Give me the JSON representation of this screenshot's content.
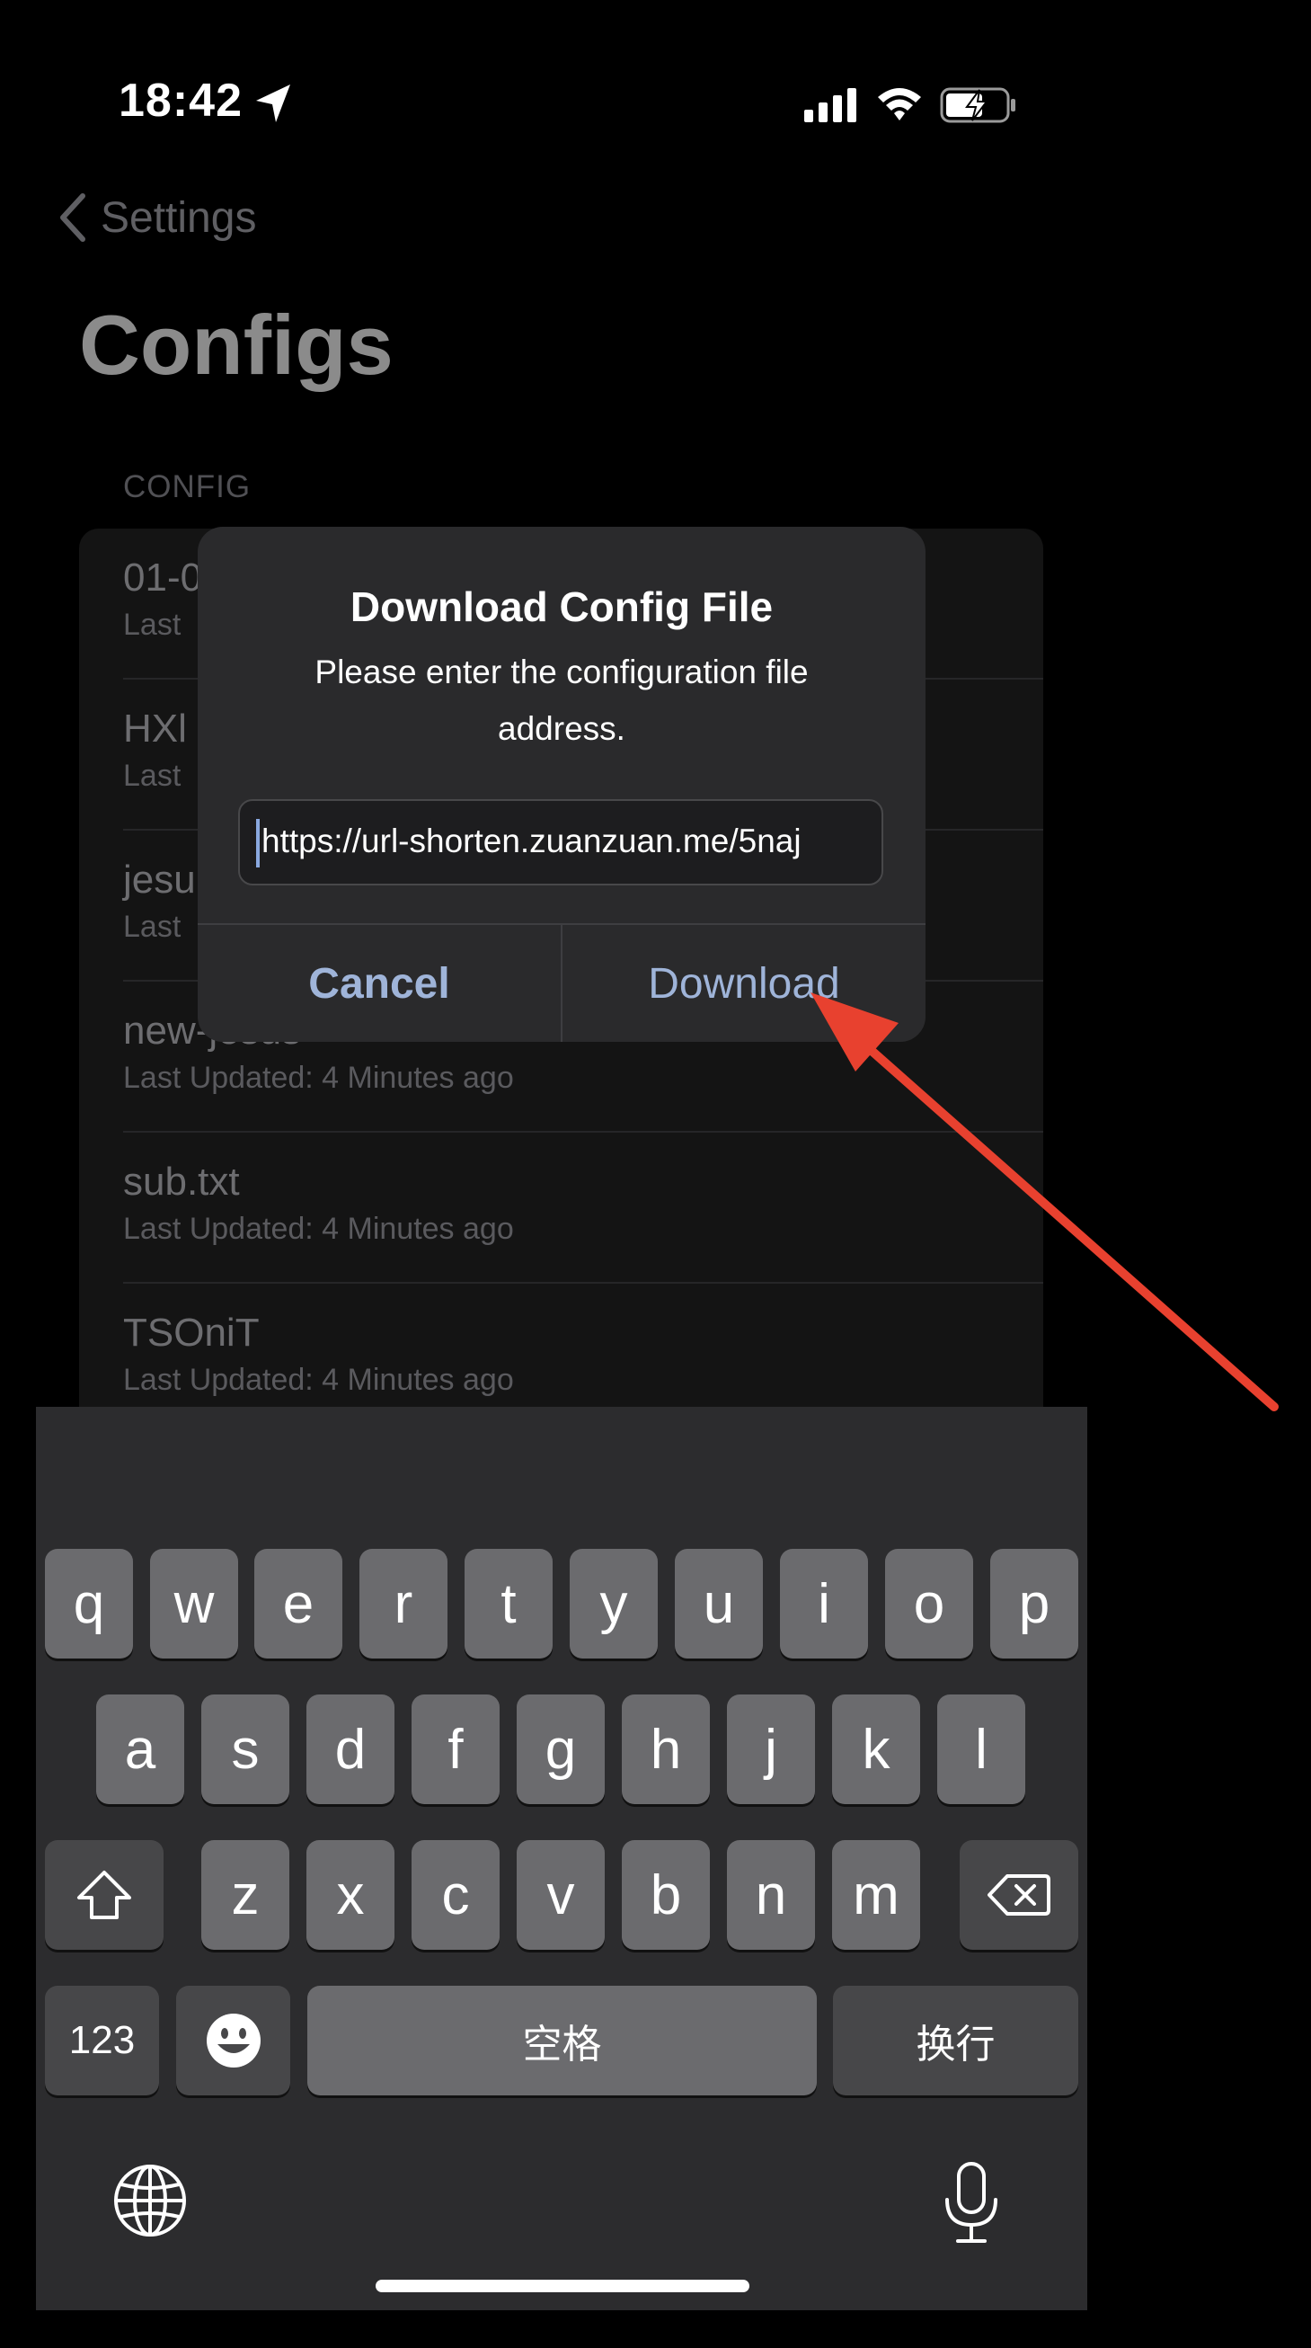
{
  "status_bar": {
    "time": "18:42",
    "icons": [
      "location-arrow-icon",
      "cellular-signal-icon",
      "wifi-icon",
      "battery-charging-icon"
    ]
  },
  "nav": {
    "back_label": "Settings"
  },
  "page": {
    "title": "Configs",
    "section_header": "CONFIG"
  },
  "configs": [
    {
      "name": "01-0",
      "subtitle": "Last"
    },
    {
      "name": "HXl",
      "subtitle": "Last"
    },
    {
      "name": "jesu",
      "subtitle": "Last"
    },
    {
      "name": "new-jesus",
      "subtitle": "Last Updated: 4 Minutes ago"
    },
    {
      "name": "sub.txt",
      "subtitle": "Last Updated: 4 Minutes ago"
    },
    {
      "name": "TSOniT",
      "subtitle": "Last Updated: 4 Minutes ago"
    }
  ],
  "alert": {
    "title": "Download Config File",
    "message": "Please enter the configuration file address.",
    "field_value": "https://url-shorten.zuanzuan.me/5naj",
    "cancel_label": "Cancel",
    "download_label": "Download"
  },
  "keyboard": {
    "row1": [
      "q",
      "w",
      "e",
      "r",
      "t",
      "y",
      "u",
      "i",
      "o",
      "p"
    ],
    "row2": [
      "a",
      "s",
      "d",
      "f",
      "g",
      "h",
      "j",
      "k",
      "l"
    ],
    "row3": [
      "z",
      "x",
      "c",
      "v",
      "b",
      "n",
      "m"
    ],
    "numbers_label": "123",
    "space_label": "空格",
    "return_label": "换行"
  },
  "colors": {
    "accent_button": "#9fb4d9",
    "annotation_arrow": "#e8412f",
    "keyboard_bg": "#2c2c2e"
  }
}
